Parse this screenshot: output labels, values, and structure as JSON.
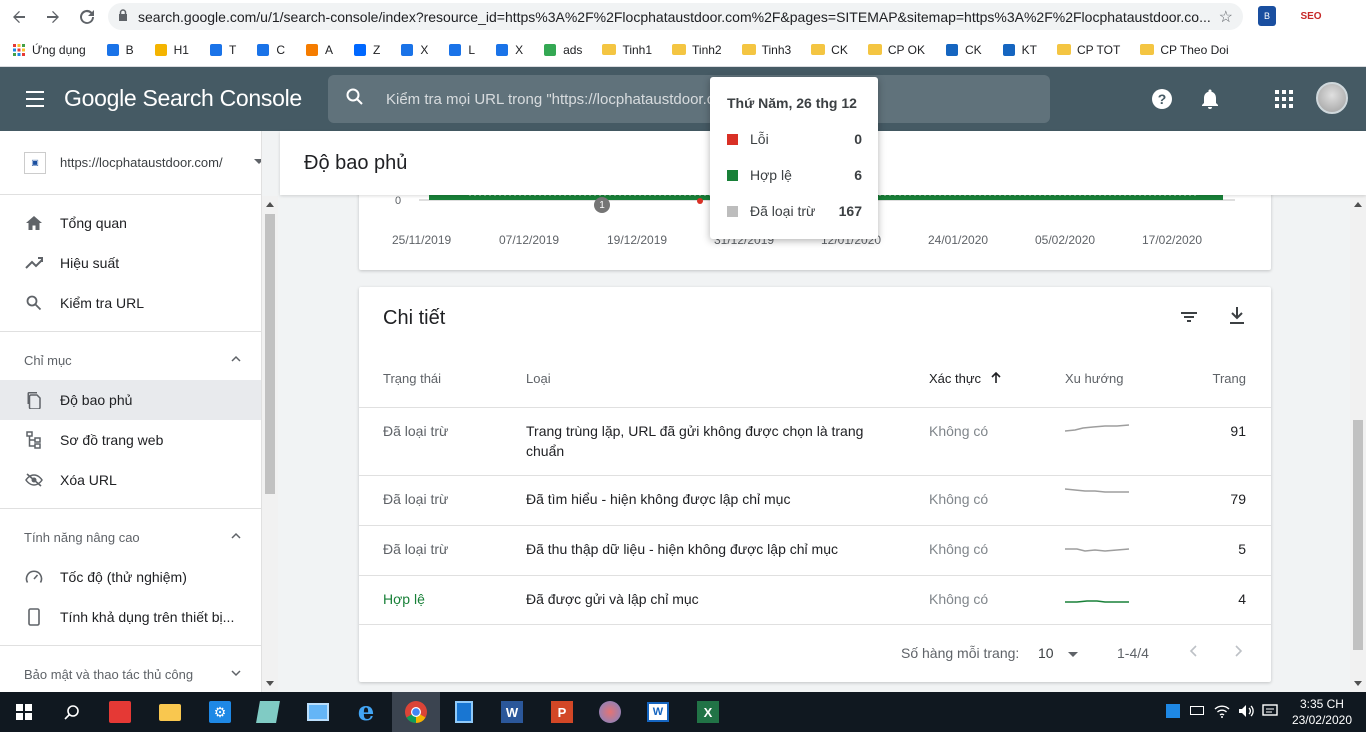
{
  "browser": {
    "url": "search.google.com/u/1/search-console/index?resource_id=https%3A%2F%2Flocphataustdoor.com%2F&pages=SITEMAP&sitemap=https%3A%2F%2Flocphataustdoor.co...",
    "bookmarks": [
      {
        "label": "Ứng dụng",
        "icon": "apps-icon"
      },
      {
        "label": "B",
        "icon": "site-icon"
      },
      {
        "label": "H1",
        "icon": "bars-icon"
      },
      {
        "label": "T",
        "icon": "site-icon"
      },
      {
        "label": "C",
        "icon": "site-icon"
      },
      {
        "label": "A",
        "icon": "analytics-icon"
      },
      {
        "label": "Z",
        "icon": "zalo-icon"
      },
      {
        "label": "X",
        "icon": "site-icon"
      },
      {
        "label": "L",
        "icon": "site-icon"
      },
      {
        "label": "X",
        "icon": "site-icon"
      },
      {
        "label": "ads",
        "icon": "ads-icon"
      },
      {
        "label": "Tinh1",
        "icon": "folder-icon"
      },
      {
        "label": "Tinh2",
        "icon": "folder-icon"
      },
      {
        "label": "Tinh3",
        "icon": "folder-icon"
      },
      {
        "label": "CK",
        "icon": "folder-icon"
      },
      {
        "label": "CP OK",
        "icon": "folder-icon"
      },
      {
        "label": "CK",
        "icon": "globe-icon"
      },
      {
        "label": "KT",
        "icon": "globe-icon"
      },
      {
        "label": "CP TOT",
        "icon": "folder-icon"
      },
      {
        "label": "CP Theo Doi",
        "icon": "folder-icon"
      }
    ]
  },
  "header": {
    "logo": "Google Search Console",
    "search_placeholder": "Kiểm tra mọi URL trong \"https://locphataustdoor.com/\""
  },
  "sidebar": {
    "property": "https://locphataustdoor.com/",
    "top_items": [
      {
        "label": "Tổng quan",
        "icon": "home-icon"
      },
      {
        "label": "Hiệu suất",
        "icon": "trending-icon"
      },
      {
        "label": "Kiểm tra URL",
        "icon": "search-icon"
      }
    ],
    "section_index": "Chỉ mục",
    "index_items": [
      {
        "label": "Độ bao phủ",
        "icon": "coverage-icon"
      },
      {
        "label": "Sơ đồ trang web",
        "icon": "sitemap-icon"
      },
      {
        "label": "Xóa URL",
        "icon": "removal-icon"
      }
    ],
    "section_advanced": "Tính năng nâng cao",
    "advanced_items": [
      {
        "label": "Tốc độ (thử nghiệm)",
        "icon": "speed-icon"
      },
      {
        "label": "Tính khả dụng trên thiết bị...",
        "icon": "mobile-icon"
      }
    ],
    "section_security": "Bảo mật và thao tác thủ công"
  },
  "main": {
    "title": "Độ bao phủ",
    "chart": {
      "zero_label": "0",
      "dates": [
        "25/11/2019",
        "07/12/2019",
        "19/12/2019",
        "31/12/2019",
        "12/01/2020",
        "24/01/2020",
        "05/02/2020",
        "17/02/2020"
      ],
      "annotation": "1"
    },
    "details": {
      "title": "Chi tiết",
      "columns": {
        "status": "Trạng thái",
        "type": "Loại",
        "validation": "Xác thực",
        "trend": "Xu hướng",
        "pages": "Trang"
      },
      "rows": [
        {
          "status": "Đã loại trừ",
          "type": "Trang trùng lặp, URL đã gửi không được chọn là trang chuẩn",
          "validation": "Không có",
          "pages": "91"
        },
        {
          "status": "Đã loại trừ",
          "type": "Đã tìm hiểu - hiện không được lập chỉ mục",
          "validation": "Không có",
          "pages": "79"
        },
        {
          "status": "Đã loại trừ",
          "type": "Đã thu thập dữ liệu - hiện không được lập chỉ mục",
          "validation": "Không có",
          "pages": "5"
        },
        {
          "status": "Hợp lệ",
          "type": "Đã được gửi và lập chỉ mục",
          "validation": "Không có",
          "pages": "4"
        }
      ],
      "rows_per_page_label": "Số hàng mỗi trang:",
      "rows_per_page": "10",
      "range": "1-4/4"
    },
    "tooltip": {
      "date": "Thứ Năm, 26 thg 12",
      "items": [
        {
          "label": "Lỗi",
          "value": "0",
          "color": "#d93025"
        },
        {
          "label": "Hợp lệ",
          "value": "6",
          "color": "#188038"
        },
        {
          "label": "Đã loại trừ",
          "value": "167",
          "color": "#bdbdbd"
        }
      ]
    }
  },
  "taskbar": {
    "time": "3:35 CH",
    "date": "23/02/2020"
  },
  "colors": {
    "header_bg": "#455a64",
    "valid_green": "#188038",
    "error_red": "#d93025",
    "excluded_gray": "#bdbdbd"
  }
}
